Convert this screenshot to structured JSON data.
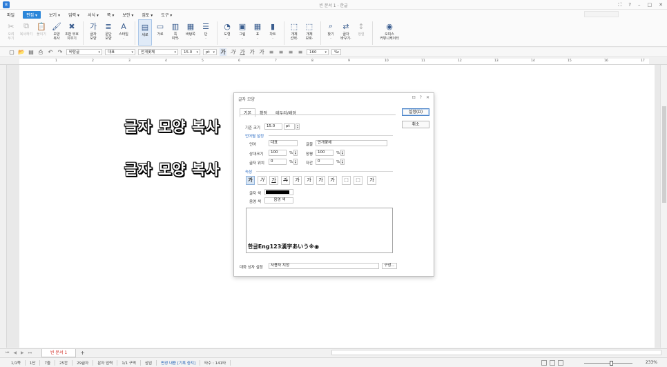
{
  "window": {
    "title": "빈 문서 1 - 한글",
    "controls": [
      "⛶",
      "?",
      "–",
      "□",
      "✕"
    ]
  },
  "menu": {
    "items": [
      {
        "label": "파일"
      },
      {
        "label": "편집 ▾",
        "active": true
      },
      {
        "label": "보기 ▾"
      },
      {
        "label": "입력 ▾"
      },
      {
        "label": "서식 ▾"
      },
      {
        "label": "쪽 ▾"
      },
      {
        "label": "보안 ▾"
      },
      {
        "label": "검토 ▾"
      },
      {
        "label": "도구 ▾"
      }
    ]
  },
  "ribbon": {
    "buttons": [
      {
        "icon": "cut-icon",
        "glyph": "✂",
        "label": "오려\n두기",
        "disabled": true
      },
      {
        "icon": "copy-icon",
        "glyph": "⧉",
        "label": "복사하기",
        "disabled": true
      },
      {
        "icon": "paste-icon",
        "glyph": "📋",
        "label": "붙이기\n·",
        "disabled": true
      },
      {
        "icon": "format-copy-icon",
        "glyph": "🖌",
        "label": "모양\n복사"
      },
      {
        "icon": "clear-format-icon",
        "glyph": "✖",
        "label": "조판 부호\n지우기"
      },
      {
        "sep": true
      },
      {
        "icon": "char-shape-icon",
        "glyph": "가",
        "label": "글자\n모양"
      },
      {
        "icon": "para-shape-icon",
        "glyph": "≣",
        "label": "문단\n모양"
      },
      {
        "icon": "style-icon",
        "glyph": "A",
        "label": "스타일\n·"
      },
      {
        "sep": true
      },
      {
        "icon": "vertical-icon",
        "glyph": "▤",
        "label": "세로",
        "on": true
      },
      {
        "icon": "horizontal-icon",
        "glyph": "▭",
        "label": "가로"
      },
      {
        "icon": "margin-icon",
        "glyph": "▥",
        "label": "쪽\n여백·"
      },
      {
        "icon": "background-icon",
        "glyph": "▦",
        "label": "바탕쪽\n·"
      },
      {
        "icon": "column-icon",
        "glyph": "☰",
        "label": "단\n·"
      },
      {
        "sep": true
      },
      {
        "icon": "shape-icon",
        "glyph": "◔",
        "label": "도형\n·"
      },
      {
        "icon": "picture-icon",
        "glyph": "▣",
        "label": "그림\n·"
      },
      {
        "icon": "table-icon",
        "glyph": "▦",
        "label": "표\n·"
      },
      {
        "icon": "chart-icon",
        "glyph": "▮",
        "label": "차트\n·"
      },
      {
        "sep": true
      },
      {
        "icon": "object-select-icon",
        "glyph": "⬚",
        "label": "개체\n선택·"
      },
      {
        "icon": "object-protect-icon",
        "glyph": "⬚",
        "label": "개체\n보호·"
      },
      {
        "sep": true
      },
      {
        "icon": "find-icon",
        "glyph": "⌕",
        "label": "찾기\n·"
      },
      {
        "icon": "replace-icon",
        "glyph": "⇄",
        "label": "글자\n바꾸기·"
      },
      {
        "icon": "sort-icon",
        "glyph": "↕",
        "label": "정렬",
        "disabled": true
      },
      {
        "sep": true
      },
      {
        "icon": "office-connector-icon",
        "glyph": "◉",
        "label": "오피스\n커뮤니케이터",
        "wide": true
      }
    ]
  },
  "toolbar2": {
    "style": "바탕글",
    "lang": "대표",
    "font": "안개꽃체",
    "size": "15.0",
    "unit": "pt",
    "zoom": "160",
    "zoom_unit": "%"
  },
  "ruler": {
    "ticks": [
      "1",
      "2",
      "3",
      "4",
      "5",
      "6",
      "7",
      "8",
      "9",
      "10",
      "11",
      "12",
      "13",
      "14",
      "15",
      "16",
      "17"
    ]
  },
  "document": {
    "line1": "글자 모양 복사",
    "line2": "글자 모양 복사"
  },
  "dialog": {
    "title": "글자 모양",
    "tabs": [
      "기본",
      "확장",
      "테두리/배경"
    ],
    "ok": "설정(D)",
    "cancel": "취소",
    "base_size_label": "기준 크기",
    "base_size": "15.0",
    "base_size_unit": "pt",
    "lang_section": "언어별 설정",
    "lang_label": "언어",
    "lang_value": "대표",
    "font_label": "글꼴",
    "font_value": "안개꽃체",
    "rel_size_label": "상대크기",
    "rel_size": "100",
    "width_label": "장평",
    "width": "100",
    "pos_label": "글자 위치",
    "pos": "0",
    "spacing_label": "자간",
    "spacing": "0",
    "pct": "%",
    "attr_section": "속성",
    "attr_buttons": [
      "가",
      "가",
      "가",
      "가",
      "가",
      "가",
      "가",
      "가",
      "⬚",
      "⬚",
      "가"
    ],
    "color_label": "글자 색",
    "shade_label": "음영 색",
    "shade_value": "음영 색",
    "preview": "한글Eng123漢字あいう※◉",
    "preset_label": "대화 상자 설정",
    "preset_value": "사용자 지정",
    "config_btn": "구성..."
  },
  "tabbar": {
    "doc_tab": "빈 문서 1",
    "add": "+"
  },
  "status": {
    "items": [
      {
        "text": "1/1쪽"
      },
      {
        "text": "1단"
      },
      {
        "text": "7줄"
      },
      {
        "text": "25칸"
      },
      {
        "text": "29글자"
      },
      {
        "text": "문자 입력"
      },
      {
        "text": "1/1 구역"
      },
      {
        "text": "삽입"
      },
      {
        "text": "변경 내용 [기록 중지]",
        "blue": true
      },
      {
        "text": "타수 : 141타"
      }
    ],
    "zoom": "233%"
  }
}
